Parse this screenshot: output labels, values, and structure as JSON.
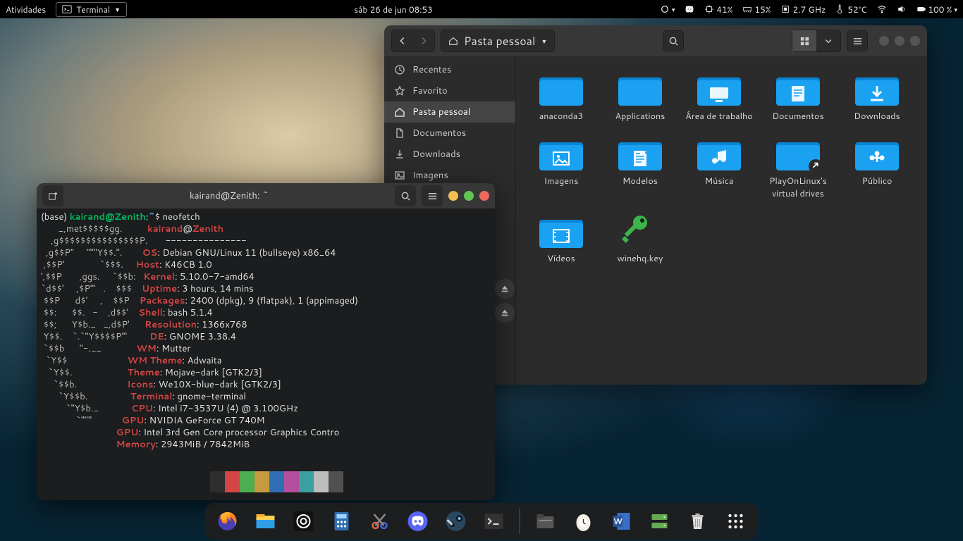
{
  "topbar": {
    "activities": "Atividades",
    "app_name": "Terminal",
    "clock": "sáb 26 de jun  08:53",
    "cpu_pct": "41%",
    "mem_pct": "15%",
    "freq": "2.7 GHz",
    "temp": "52°C",
    "battery": "100 %"
  },
  "files": {
    "path_label": "Pasta pessoal",
    "sidebar": [
      {
        "icon": "clock",
        "label": "Recentes"
      },
      {
        "icon": "star",
        "label": "Favorito"
      },
      {
        "icon": "home",
        "label": "Pasta pessoal",
        "active": true
      },
      {
        "icon": "doc",
        "label": "Documentos"
      },
      {
        "icon": "download",
        "label": "Downloads"
      },
      {
        "icon": "image",
        "label": "Imagens"
      }
    ],
    "items": [
      {
        "type": "folder",
        "variant": "plain",
        "label": "anaconda3"
      },
      {
        "type": "folder",
        "variant": "plain",
        "label": "Applications"
      },
      {
        "type": "folder",
        "variant": "desktop",
        "label": "Área de trabalho"
      },
      {
        "type": "folder",
        "variant": "doc",
        "label": "Documentos"
      },
      {
        "type": "folder",
        "variant": "download",
        "label": "Downloads"
      },
      {
        "type": "folder",
        "variant": "image",
        "label": "Imagens"
      },
      {
        "type": "folder",
        "variant": "template",
        "label": "Modelos"
      },
      {
        "type": "folder",
        "variant": "music",
        "label": "Música"
      },
      {
        "type": "folder",
        "variant": "plain",
        "label": "PlayOnLinux's virtual drives",
        "link": true
      },
      {
        "type": "folder",
        "variant": "public",
        "label": "Público"
      },
      {
        "type": "folder",
        "variant": "video",
        "label": "Vídeos"
      },
      {
        "type": "key",
        "label": "winehq.key"
      }
    ]
  },
  "terminal": {
    "title": "kairand@Zenith: ~",
    "prompt_base": "(base) ",
    "prompt_user": "kairand@Zenith",
    "prompt_path": ":~$ ",
    "command": "neofetch",
    "info_user": "kairand",
    "info_at": "@",
    "info_host": "Zenith",
    "info_sep": "---------------",
    "lines": [
      {
        "k": "OS",
        "v": "Debian GNU/Linux 11 (bullseye) x86_64"
      },
      {
        "k": "Host",
        "v": "K46CB 1.0"
      },
      {
        "k": "Kernel",
        "v": "5.10.0-7-amd64"
      },
      {
        "k": "Uptime",
        "v": "3 hours, 14 mins"
      },
      {
        "k": "Packages",
        "v": "2400 (dpkg), 9 (flatpak), 1 (appimaged)"
      },
      {
        "k": "Shell",
        "v": "bash 5.1.4"
      },
      {
        "k": "Resolution",
        "v": "1366x768"
      },
      {
        "k": "DE",
        "v": "GNOME 3.38.4"
      },
      {
        "k": "WM",
        "v": "Mutter"
      },
      {
        "k": "WM Theme",
        "v": "Adwaita"
      },
      {
        "k": "Theme",
        "v": "Mojave-dark [GTK2/3]"
      },
      {
        "k": "Icons",
        "v": "We10X-blue-dark [GTK2/3]"
      },
      {
        "k": "Terminal",
        "v": "gnome-terminal"
      },
      {
        "k": "CPU",
        "v": "Intel i7-3537U (4) @ 3.100GHz"
      },
      {
        "k": "GPU",
        "v": "NVIDIA GeForce GT 740M"
      },
      {
        "k": "GPU",
        "v": "Intel 3rd Gen Core processor Graphics Contro"
      },
      {
        "k": "Memory",
        "v": "2943MiB / 7842MiB"
      }
    ],
    "swatches": [
      "#2e2e2e",
      "#d64545",
      "#4caf50",
      "#c49b3f",
      "#2f6fb3",
      "#b24f9e",
      "#3aa0a0",
      "#bdbdbd",
      "#505050",
      "#e06c6c",
      "#6fcf6f",
      "#d8b65a",
      "#5a8fd8",
      "#c877b8",
      "#62bcbc",
      "#eeeeee"
    ],
    "logo": [
      "       _,met$$$$$gg.          ",
      "    ,g$$$$$$$$$$$$$$$P.       ",
      "  ,g$$P\"     \"\"\"Y$$.\".        ",
      " ,$$P'              `$$$.     ",
      "',$$P       ,ggs.     `$$b:   ",
      "`d$$'     ,$P\"'   .    $$$    ",
      " $$P      d$'     ,    $$P    ",
      " $$:      $$.   -    ,d$$'    ",
      " $$;      Y$b._   _,d$P'      ",
      " Y$$.    `.`\"Y$$$$P\"'         ",
      " `$$b      \"-.__              ",
      "  `Y$$                        ",
      "   `Y$$.                      ",
      "     `$$b.                    ",
      "       `Y$$b.                 ",
      "          `\"Y$b._             ",
      "              `\"\"\"            "
    ]
  },
  "dock": [
    {
      "name": "firefox"
    },
    {
      "name": "file-explorer"
    },
    {
      "name": "clementine"
    },
    {
      "name": "calculator"
    },
    {
      "name": "snip"
    },
    {
      "name": "discord"
    },
    {
      "name": "steam"
    },
    {
      "name": "terminal"
    },
    {
      "sep": true
    },
    {
      "name": "files"
    },
    {
      "name": "egg-timer"
    },
    {
      "name": "word"
    },
    {
      "name": "drives"
    },
    {
      "name": "trash"
    },
    {
      "name": "apps-grid"
    }
  ]
}
